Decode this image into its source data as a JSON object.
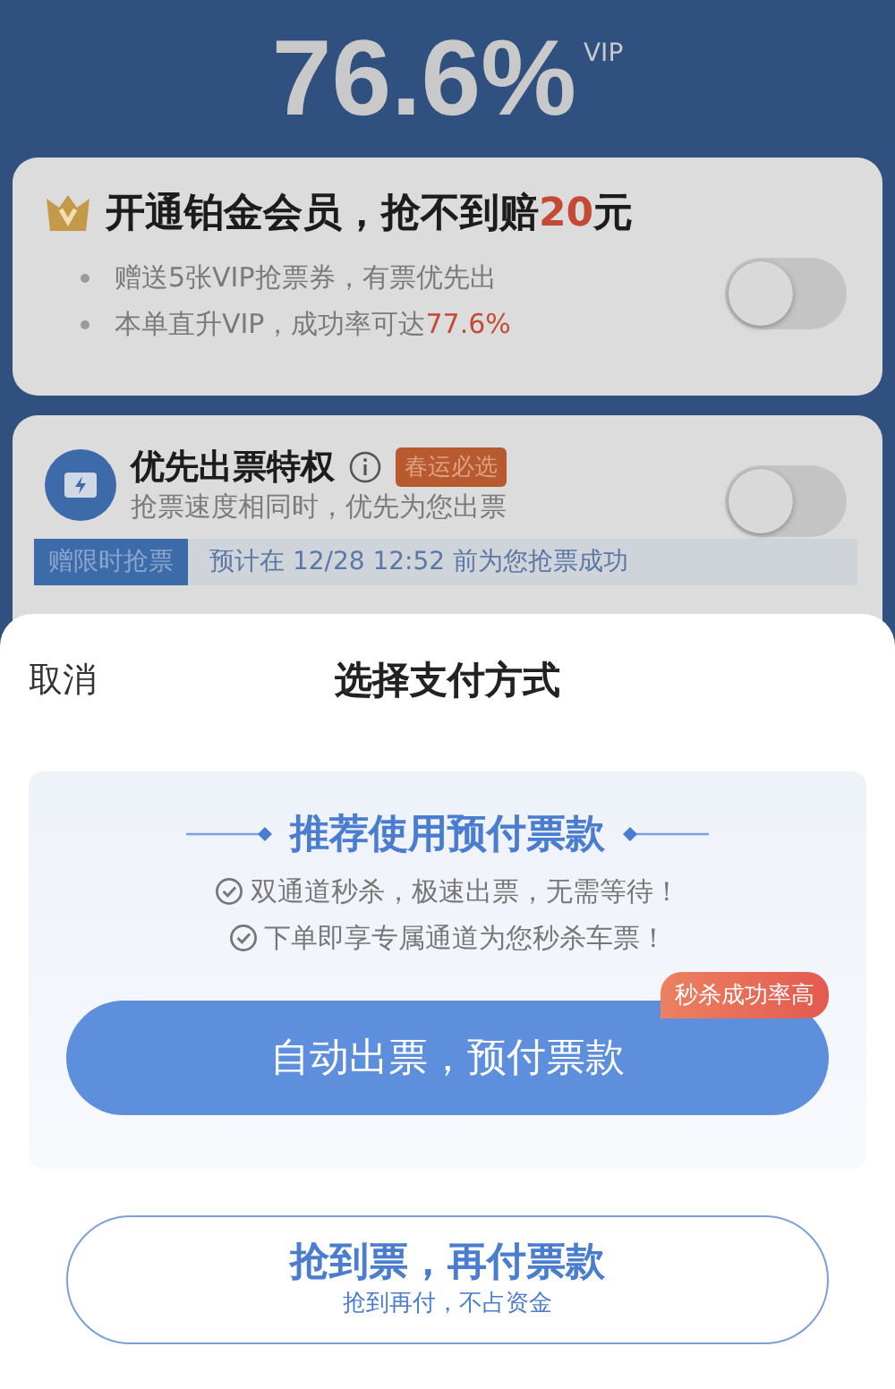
{
  "rate": {
    "value": "76.6%",
    "badge": "VIP"
  },
  "vip_card": {
    "title": "开通铂金会员，抢不到赔",
    "title_highlight": "20",
    "title_suffix": "元",
    "on": false,
    "bullets": [
      {
        "text": "赠送5张VIP抢票券，有票优先出"
      },
      {
        "text": "本单直升VIP，成功率可达",
        "highlight": "77.6%"
      }
    ]
  },
  "priority_card": {
    "title": "优先出票特权",
    "tag": "春运必选",
    "subtitle": "抢票速度相同时，优先为您出票",
    "on": false,
    "gift_label": "赠限时抢票",
    "note": "预计在 12/28 12:52 前为您抢票成功"
  },
  "sheet": {
    "cancel": "取消",
    "title": "选择支付方式",
    "recommend": {
      "heading": "推荐使用预付票款",
      "points": [
        "双通道秒杀，极速出票，无需等待！",
        "下单即享专属通道为您秒杀车票！"
      ]
    },
    "primary": {
      "label": "自动出票，预付票款",
      "badge": "秒杀成功率高"
    },
    "secondary": {
      "label": "抢到票，再付票款",
      "sublabel": "抢到再付，不占资金"
    }
  }
}
